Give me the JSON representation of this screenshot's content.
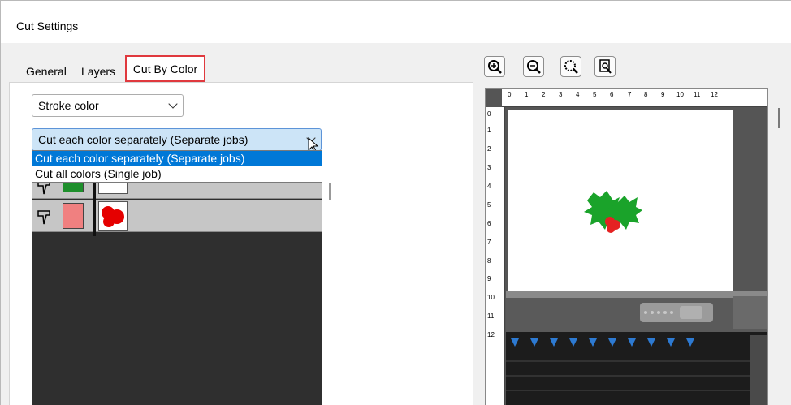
{
  "window": {
    "title": "Cut Settings"
  },
  "tabs": [
    {
      "label": "General"
    },
    {
      "label": "Layers"
    },
    {
      "label": "Cut By Color"
    }
  ],
  "stroke_select": {
    "value": "Stroke color"
  },
  "mode_select": {
    "value": "Cut each color separately (Separate jobs)",
    "options": [
      "Cut each color separately (Separate jobs)",
      "Cut all colors (Single job)"
    ]
  },
  "layers": [
    {
      "color": "#1e8f2c"
    },
    {
      "color": "#f08080"
    }
  ],
  "ruler": {
    "h": [
      "0",
      "1",
      "2",
      "3",
      "4",
      "5",
      "6",
      "7",
      "8",
      "9",
      "10",
      "11",
      "12"
    ],
    "v": [
      "0",
      "1",
      "2",
      "3",
      "4",
      "5",
      "6",
      "7",
      "8",
      "9",
      "10",
      "11",
      "12"
    ]
  },
  "colors": {
    "accent": "#0078d7",
    "highlight": "#e0393e",
    "holly": "#1aa32a",
    "berry": "#e52222"
  }
}
